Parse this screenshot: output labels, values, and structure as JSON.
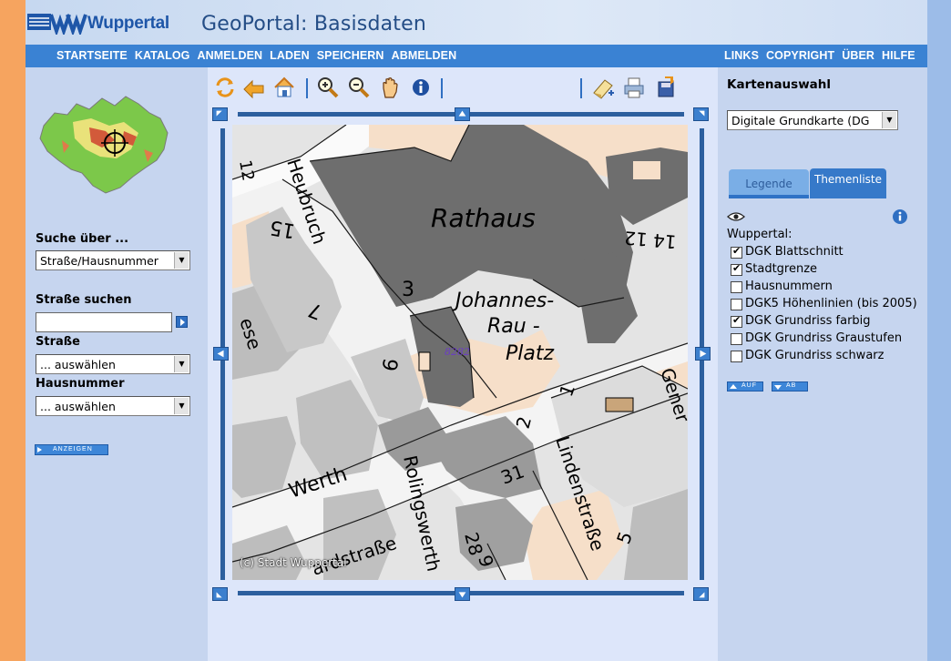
{
  "header": {
    "logo_text": "Wuppertal",
    "title": "GeoPortal: Basisdaten"
  },
  "nav": {
    "left": [
      "STARTSEITE",
      "KATALOG",
      "ANMELDEN",
      "LADEN",
      "SPEICHERN",
      "ABMELDEN"
    ],
    "right": [
      "LINKS",
      "COPYRIGHT",
      "ÜBER",
      "HILFE"
    ]
  },
  "search": {
    "suche_label": "Suche über ...",
    "suche_value": "Straße/Hausnummer",
    "strasse_suchen_label": "Straße suchen",
    "strasse_suchen_value": "",
    "strasse_label": "Straße",
    "strasse_value": "... auswählen",
    "hausnummer_label": "Hausnummer",
    "hausnummer_value": "... auswählen",
    "anzeigen_label": "ANZEIGEN"
  },
  "map": {
    "labels": {
      "rathaus": "Rathaus",
      "platz_line1": "Johannes-",
      "platz_line2": "Rau -",
      "platz_line3": "Platz",
      "heubruch": "Heubruch",
      "werth": "Werth",
      "rolingswerth": "Rolingswerth",
      "lindenstrasse": "Lindenstraße",
      "ese": "ese",
      "gener": "Gener",
      "bardstrasse": "ardstraße",
      "marker": "8282",
      "n15": "15",
      "n7": "7",
      "n3": "3",
      "n6": "6",
      "n1": "1",
      "n2": "2",
      "n31": "31",
      "n28": "28",
      "n5": "5",
      "n9": "9",
      "n1412": "14 12",
      "n12": "12"
    },
    "copyright": "(c) Stadt Wuppertal"
  },
  "right": {
    "kartenauswahl_label": "Kartenauswahl",
    "kartenauswahl_value": "Digitale Grundkarte (DG",
    "tab_legende": "Legende",
    "tab_themenliste": "Themenliste",
    "group_label": "Wuppertal:",
    "themes": [
      {
        "label": "DGK Blattschnitt",
        "checked": true
      },
      {
        "label": "Stadtgrenze",
        "checked": true
      },
      {
        "label": "Hausnummern",
        "checked": false
      },
      {
        "label": "DGK5 Höhenlinien (bis 2005)",
        "checked": false
      },
      {
        "label": "DGK Grundriss farbig",
        "checked": true
      },
      {
        "label": "DGK Grundriss Graustufen",
        "checked": false
      },
      {
        "label": "DGK Grundriss schwarz",
        "checked": false
      }
    ],
    "auf_label": "AUF",
    "ab_label": "AB"
  },
  "colors": {
    "accent": "#3a82d3",
    "frame": "#2c5f9e",
    "title": "#244d86",
    "building_dark": "#6e6e6e",
    "building_peach": "#f6dfc9"
  }
}
